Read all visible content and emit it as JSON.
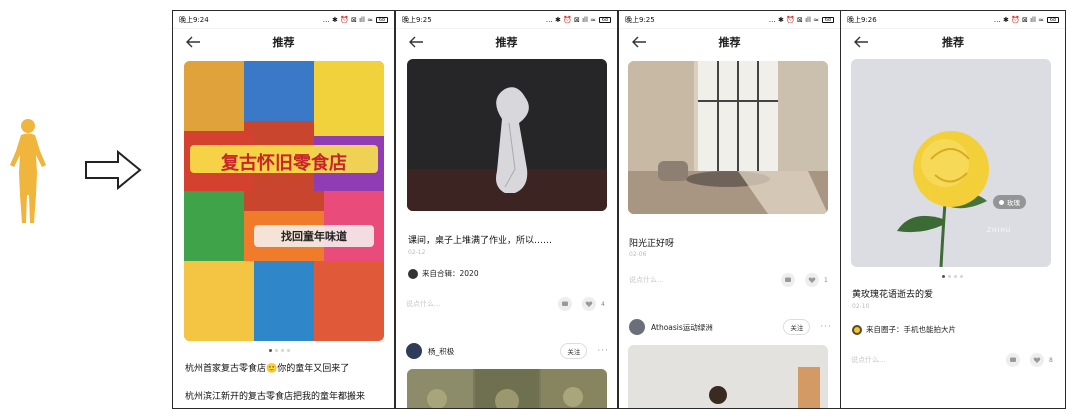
{
  "nav": {
    "title": "推荐"
  },
  "status": {
    "icons": "… ✱ ⏰ ⊠ ıll ≈"
  },
  "phones": [
    {
      "time": "晚上9:24",
      "battery": "68",
      "post_title": "杭州首家复古零食店🙂你的童年又回来了",
      "post_body": "杭州滨江新开的复古零食店把我的童年都搬来",
      "image_text_1": "复古怀旧零食店",
      "image_text_2": "找回童年味道"
    },
    {
      "time": "晚上9:25",
      "battery": "68",
      "post_title": "课间，桌子上堆满了作业，所以……",
      "date": "02-12",
      "source": "来自合辑：2020",
      "comment_placeholder": "说点什么...",
      "like_count": "4",
      "user": "杨_积极",
      "follow": "关注"
    },
    {
      "time": "晚上9:25",
      "battery": "68",
      "post_title": "阳光正好呀",
      "date": "02-06",
      "comment_placeholder": "说点什么...",
      "like_count": "1",
      "user": "Athoasis运动绿洲",
      "follow": "关注"
    },
    {
      "time": "晚上9:26",
      "battery": "68",
      "tag": "玫瑰",
      "watermark": "ZHIHU",
      "post_title": "黄玫瑰花语逝去的爱",
      "date": "02-10",
      "source": "来自圈子：手机也能拍大片",
      "comment_placeholder": "说点什么...",
      "like_count": "8"
    }
  ],
  "colors": {
    "accent": "#f5c33b",
    "figure": "#f0b53d",
    "text": "#111111"
  }
}
